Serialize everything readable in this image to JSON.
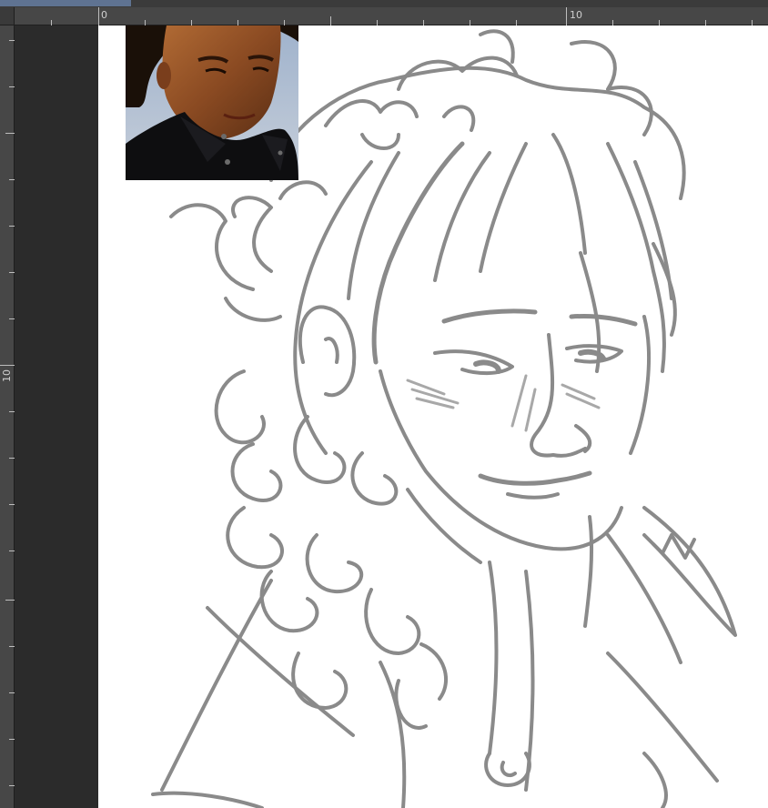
{
  "rulers": {
    "horizontal": {
      "labels": [
        "0",
        "10"
      ]
    },
    "vertical": {
      "labels": [
        "10"
      ]
    }
  },
  "reference_image": {
    "icon": "reference-photo",
    "subject": ""
  },
  "colors": {
    "workspace": "#2b2b2b",
    "ruler": "#474747",
    "canvas": "#ffffff",
    "sketch_stroke": "#8a8a8a",
    "active_tab": "#5f7392"
  }
}
